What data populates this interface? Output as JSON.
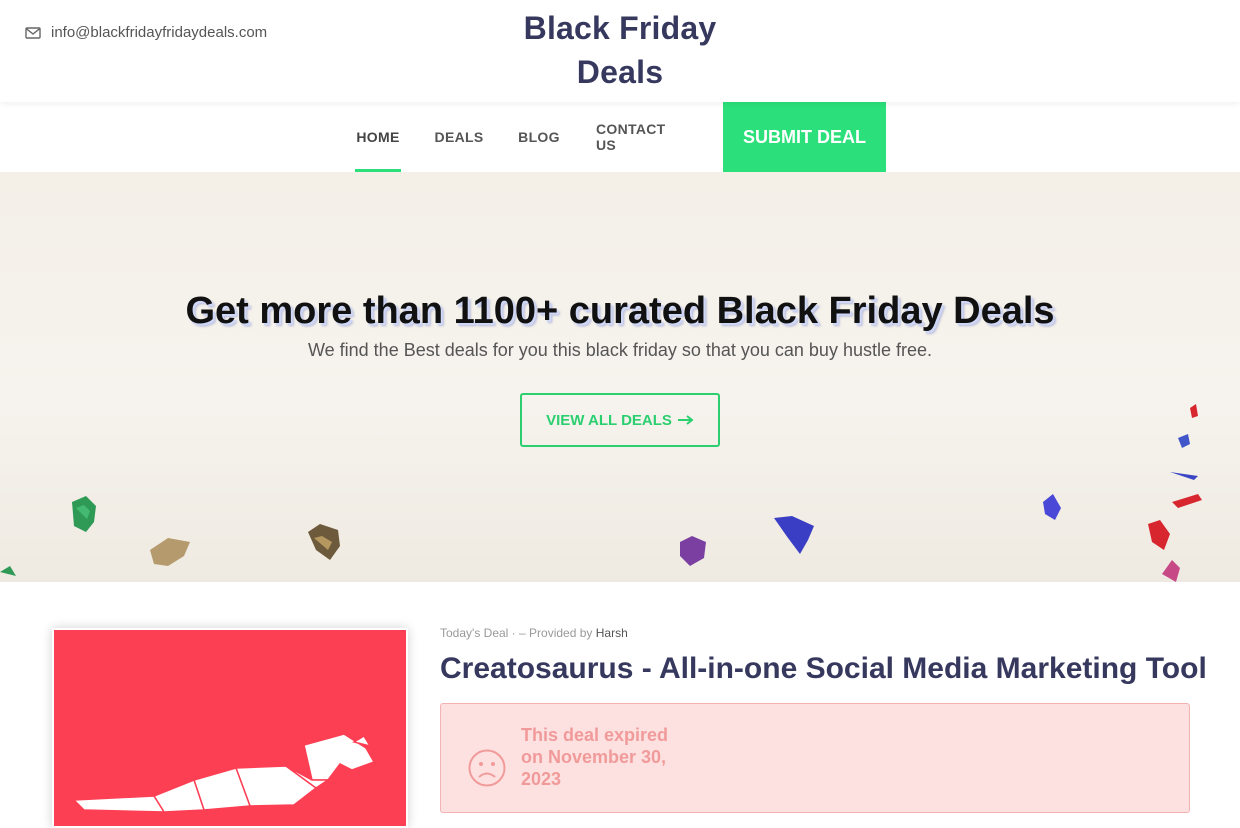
{
  "header": {
    "email": "info@blackfridayfridaydeals.com",
    "icon": "envelope-icon",
    "logo_line1": "Black Friday",
    "logo_line2": "Deals"
  },
  "nav": {
    "items": [
      {
        "label": "HOME",
        "active": true
      },
      {
        "label": "DEALS",
        "active": false
      },
      {
        "label": "BLOG",
        "active": false
      },
      {
        "label": "CONTACT US",
        "active": false
      }
    ],
    "submit_label": "SUBMIT DEAL"
  },
  "hero": {
    "title": "Get more than 1100+ curated Black Friday Deals",
    "subtitle": "We find the Best deals for you this black friday so that you can buy hustle free.",
    "button_label": "VIEW ALL DEALS",
    "button_icon": "arrow-right-icon"
  },
  "deal": {
    "tag": "Today's Deal",
    "separator": "·",
    "dash": "–",
    "provided_by": "Provided by",
    "author": "Harsh",
    "title": "Creatosaurus - All-in-one Social Media Marketing Tool",
    "expired_text": "This deal expired on November 30, 2023",
    "expired_icon": "sad-face-icon"
  },
  "colors": {
    "accent": "#2be07a",
    "brand_text": "#36385e",
    "deal_image_bg": "#fd3f54",
    "expired_bg": "#fde1e1",
    "expired_text": "#f19a9a"
  }
}
